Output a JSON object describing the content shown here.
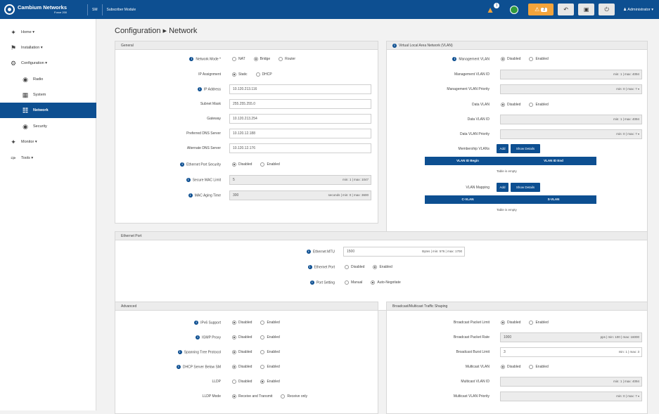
{
  "topbar": {
    "brand_name": "Cambium Networks",
    "brand_model": "Force 200",
    "mode": "SM",
    "device_name": "Subscriber Module",
    "alert_count": "1",
    "warning_count": "2",
    "user": "Administrator"
  },
  "sidebar": {
    "items": [
      {
        "label": "Home"
      },
      {
        "label": "Installation"
      },
      {
        "label": "Configuration"
      },
      {
        "label": "Radio"
      },
      {
        "label": "System"
      },
      {
        "label": "Network"
      },
      {
        "label": "Security"
      },
      {
        "label": "Monitor"
      },
      {
        "label": "Tools"
      }
    ]
  },
  "page": {
    "breadcrumb_root": "Configuration",
    "breadcrumb_sep": "▸",
    "breadcrumb_current": "Network"
  },
  "general": {
    "title": "General",
    "network_mode_label": "Network Mode *",
    "network_mode_options": [
      "NAT",
      "Bridge",
      "Router"
    ],
    "ip_assignment_label": "IP Assignment",
    "ip_assignment_options": [
      "Static",
      "DHCP"
    ],
    "ip_address_label": "IP Address",
    "ip_address": "10.120.213.116",
    "subnet_mask_label": "Subnet Mask",
    "subnet_mask": "255.255.255.0",
    "gateway_label": "Gateway",
    "gateway": "10.120.213.254",
    "pref_dns_label": "Preferred DNS Server",
    "pref_dns": "10.120.12.188",
    "alt_dns_label": "Alternate DNS Server",
    "alt_dns": "10.120.12.176",
    "eth_port_sec_label": "Ethernet Port Security",
    "eth_port_sec_options": [
      "Disabled",
      "Enabled"
    ],
    "secure_mac_label": "Secure MAC Limit",
    "secure_mac": "5",
    "secure_mac_hint": "min: 1 | max: 1047",
    "mac_aging_label": "MAC Aging Time",
    "mac_aging": "300",
    "mac_aging_hint": "seconds | min: 0 | max: 3600"
  },
  "vlan": {
    "title": "Virtual Local Area Network (VLAN)",
    "mgmt_vlan_label": "Management VLAN",
    "mgmt_vlan_options": [
      "Disabled",
      "Enabled"
    ],
    "mgmt_vlan_id_label": "Management VLAN ID",
    "mgmt_vlan_id_hint": "min: 1 | max: 4094",
    "mgmt_vlan_prio_label": "Management VLAN Priority",
    "mgmt_vlan_prio_hint": "min: 0 | max: 7",
    "data_vlan_label": "Data VLAN",
    "data_vlan_options": [
      "Disabled",
      "Enabled"
    ],
    "data_vlan_id_label": "Data VLAN ID",
    "data_vlan_id_hint": "min: 1 | max: 4094",
    "data_vlan_prio_label": "Data VLAN Priority",
    "data_vlan_prio_hint": "min: 0 | max: 7",
    "membership_label": "Membership VLANs",
    "add_label": "Add",
    "show_details_label": "Show Details",
    "membership_cols": [
      "VLAN ID Begin",
      "VLAN ID End"
    ],
    "membership_empty": "Table is empty",
    "mapping_label": "VLAN Mapping",
    "mapping_cols": [
      "C-VLAN",
      "S-VLAN"
    ],
    "mapping_empty": "Table is empty"
  },
  "ethernet": {
    "title": "Ethernet Port",
    "mtu_label": "Ethernet MTU",
    "mtu": "1500",
    "mtu_hint": "Bytes | min: 576 | max: 1700",
    "port_label": "Ethernet Port",
    "port_options": [
      "Disabled",
      "Enabled"
    ],
    "setting_label": "Port Setting",
    "setting_options": [
      "Manual",
      "Auto-Negotiate"
    ]
  },
  "advanced": {
    "title": "Advanced",
    "ipv6_label": "IPv6 Support",
    "ipv6_options": [
      "Disabled",
      "Enabled"
    ],
    "ipv4_label": "IGMP Proxy",
    "ipv4_options": [
      "Disabled",
      "Enabled"
    ],
    "stp_label": "Spanning Tree Protocol",
    "stp_options": [
      "Disabled",
      "Enabled"
    ],
    "dhcp_label": "DHCP Server Below SM",
    "dhcp_options": [
      "Disabled",
      "Enabled"
    ],
    "lldp_label": "LLDP",
    "lldp_options": [
      "Disabled",
      "Enabled"
    ],
    "lldp_mode_label": "LLDP Mode",
    "lldp_mode_options": [
      "Receive and Transmit",
      "Receive only"
    ]
  },
  "broadcast": {
    "title": "Broadcast/Multicast Traffic Shaping",
    "bc_limit_label": "Broadcast Packet Limit",
    "bc_limit_options": [
      "Disabled",
      "Enabled"
    ],
    "bc_rate_label": "Broadcast Packet Rate",
    "bc_rate": "1000",
    "bc_rate_hint": "pps | min: 100 | max: 16000",
    "bc_burst_label": "Broadcast Burst Limit",
    "bc_burst": "3",
    "bc_burst_hint": "min: 1 | max: 3",
    "mc_vlan_label": "Multicast VLAN",
    "mc_vlan_options": [
      "Disabled",
      "Enabled"
    ],
    "mc_vlan_id_label": "Multicast VLAN ID",
    "mc_vlan_id_hint": "min: 1 | max: 4094",
    "mc_prio_label": "Multicast VLAN Priority",
    "mc_prio_hint": "min: 0 | max: 7"
  }
}
